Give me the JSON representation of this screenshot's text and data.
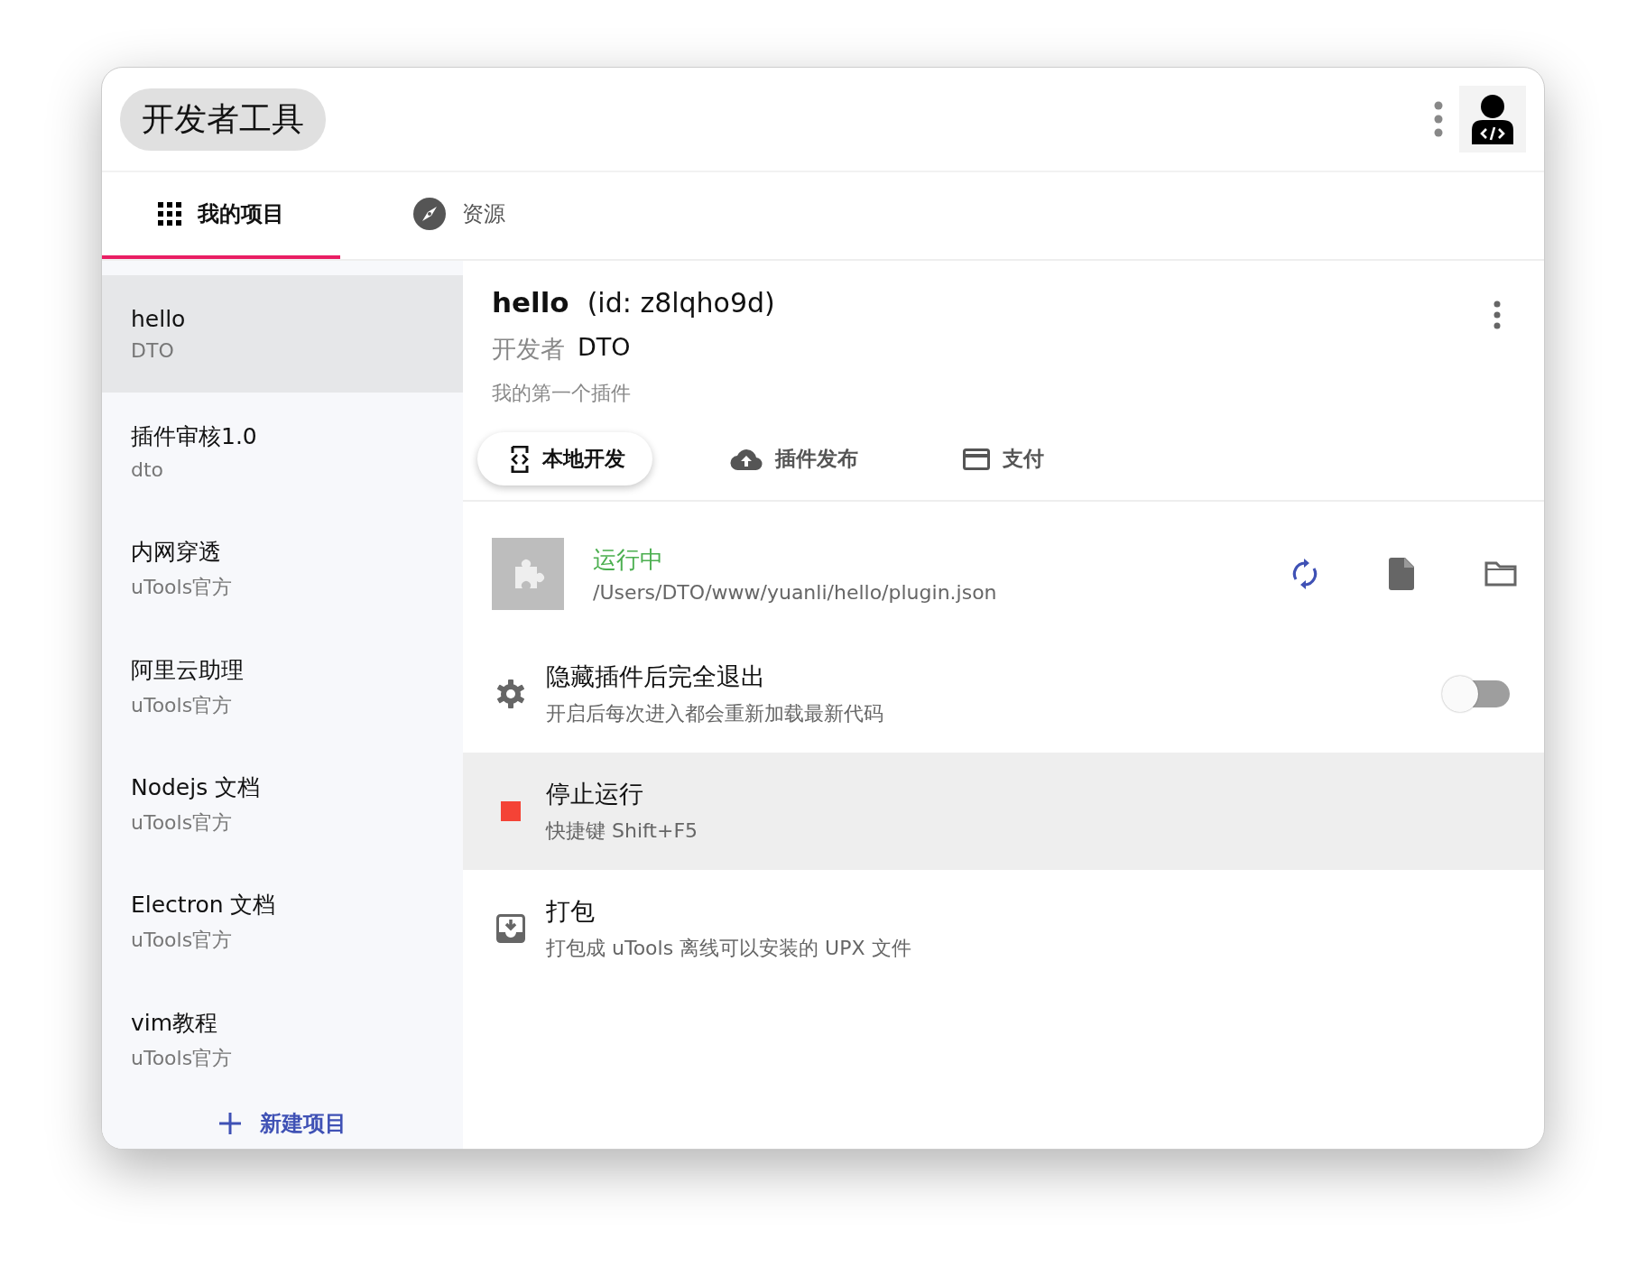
{
  "app_title": "开发者工具",
  "tabs": [
    {
      "label": "我的项目",
      "selected": true
    },
    {
      "label": "资源",
      "selected": false
    }
  ],
  "projects": [
    {
      "name": "hello",
      "author": "DTO",
      "selected": true
    },
    {
      "name": "插件审核1.0",
      "author": "dto",
      "selected": false
    },
    {
      "name": "内网穿透",
      "author": "uTools官方",
      "selected": false
    },
    {
      "name": "阿里云助理",
      "author": "uTools官方",
      "selected": false
    },
    {
      "name": "Nodejs 文档",
      "author": "uTools官方",
      "selected": false
    },
    {
      "name": "Electron 文档",
      "author": "uTools官方",
      "selected": false
    },
    {
      "name": "vim教程",
      "author": "uTools官方",
      "selected": false
    }
  ],
  "new_project": {
    "label": "新建项目"
  },
  "detail": {
    "name": "hello",
    "id_text": "(id: z8lqho9d)",
    "developer_label": "开发者",
    "developer": "DTO",
    "description": "我的第一个插件",
    "subtabs": [
      {
        "label": "本地开发",
        "selected": true
      },
      {
        "label": "插件发布",
        "selected": false
      },
      {
        "label": "支付",
        "selected": false
      }
    ],
    "status": {
      "label": "运行中",
      "path": "/Users/DTO/www/yuanli/hello/plugin.json"
    },
    "actions": [
      {
        "kind": "toggle",
        "title": "隐藏插件后完全退出",
        "subtitle": "开启后每次进入都会重新加载最新代码",
        "on": false,
        "highlighted": false
      },
      {
        "kind": "command",
        "title": "停止运行",
        "subtitle": "快捷键 Shift+F5",
        "highlighted": true
      },
      {
        "kind": "command",
        "title": "打包",
        "subtitle": "打包成 uTools 离线可以安装的 UPX 文件",
        "highlighted": false
      }
    ]
  }
}
